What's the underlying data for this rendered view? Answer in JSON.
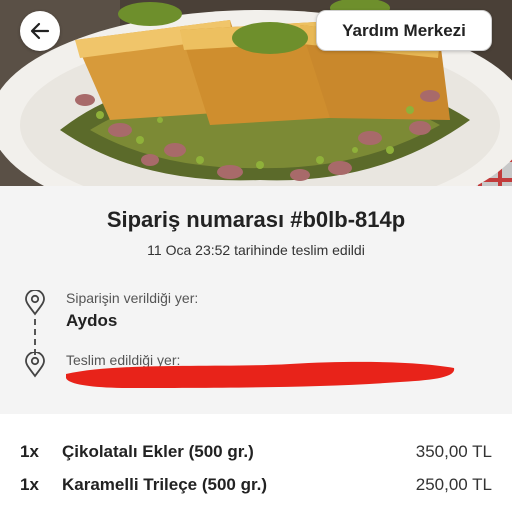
{
  "header": {
    "help_label": "Yardım Merkezi"
  },
  "order": {
    "title": "Sipariş numarası #b0lb-814p",
    "delivered_text": "11 Oca 23:52 tarihinde teslim edildi"
  },
  "locations": {
    "from_label": "Siparişin verildiği yer:",
    "from_value": "Aydos",
    "to_label": "Teslim edildiği yer:"
  },
  "items": [
    {
      "qty": "1x",
      "name": "Çikolatalı Ekler (500 gr.)",
      "price": "350,00 TL"
    },
    {
      "qty": "1x",
      "name": "Karamelli Trileçe (500 gr.)",
      "price": "250,00 TL"
    }
  ],
  "icons": {
    "back": "arrow-left-icon",
    "pin": "location-pin-icon"
  },
  "colors": {
    "redaction": "#e8231a",
    "panel": "#f4f4f4"
  }
}
